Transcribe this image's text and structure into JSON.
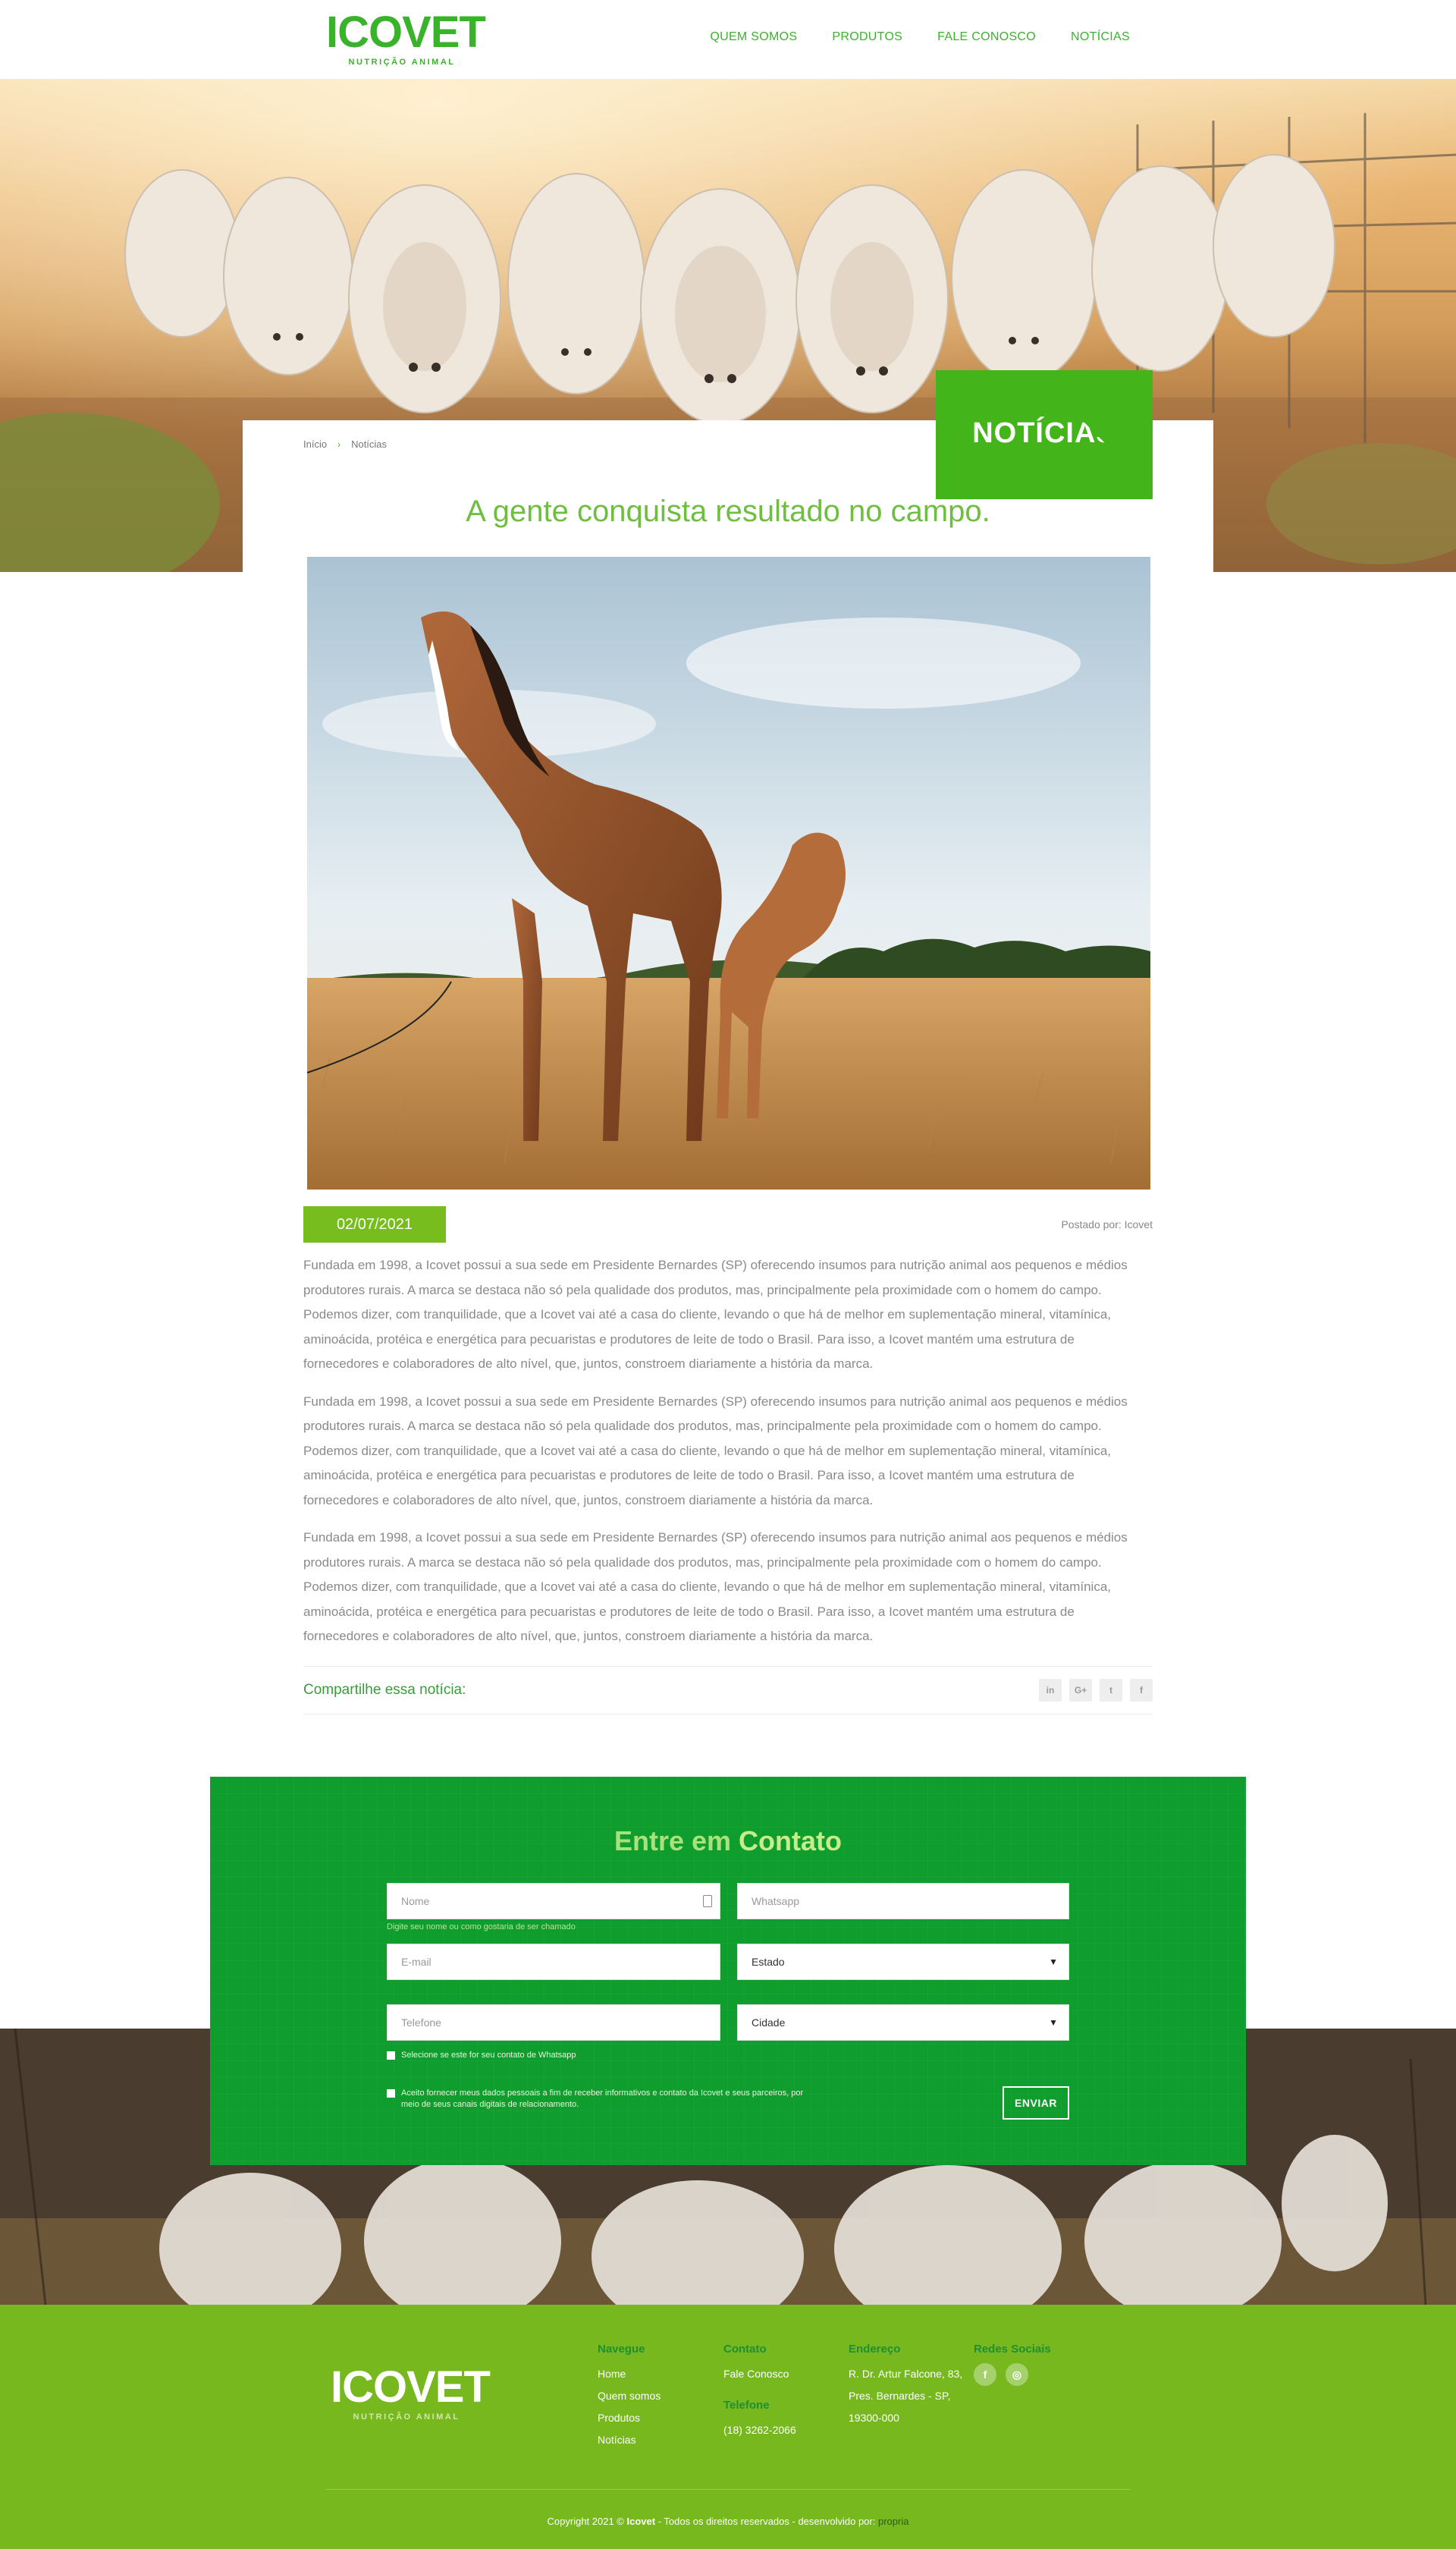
{
  "brand": {
    "logo_text": "ICOVET",
    "logo_subtitle": "NUTRIÇÃO ANIMAL",
    "accent": "#3bb22c",
    "green_box": "#43b51a",
    "contact_bg": "#0f9d2d",
    "footer_bg": "#76b81e"
  },
  "nav": {
    "items": [
      "QUEM SOMOS",
      "PRODUTOS",
      "FALE CONOSCO",
      "NOTÍCIAS"
    ]
  },
  "hero": {
    "title": "NOTÍCIAS"
  },
  "breadcrumb": {
    "home": "Início",
    "separator": "›",
    "current": "Notícias"
  },
  "article": {
    "title": "A gente conquista resultado no campo.",
    "date": "02/07/2021",
    "posted_by": "Postado por: Icovet",
    "paragraphs": [
      "Fundada em 1998, a Icovet possui a sua sede em Presidente Bernardes (SP) oferecendo insumos para nutrição animal aos pequenos e médios produtores rurais. A marca se destaca não só pela qualidade dos produtos, mas, principalmente pela proximidade com o homem do campo. Podemos dizer, com tranquilidade, que a Icovet vai até a casa do cliente, levando o que há de melhor em suplementação mineral, vitamínica, aminoácida, protéica e energética para pecuaristas e produtores de leite de todo o Brasil. Para isso, a Icovet mantém uma estrutura de fornecedores e colaboradores de alto nível, que, juntos, constroem diariamente a história da marca.",
      "Fundada em 1998, a Icovet possui a sua sede em Presidente Bernardes (SP) oferecendo insumos para nutrição animal aos pequenos e médios produtores rurais. A marca se destaca não só pela qualidade dos produtos, mas, principalmente pela proximidade com o homem do campo. Podemos dizer, com tranquilidade, que a Icovet vai até a casa do cliente, levando o que há de melhor em suplementação mineral, vitamínica, aminoácida, protéica e energética para pecuaristas e produtores de leite de todo o Brasil. Para isso, a Icovet mantém uma estrutura de fornecedores e colaboradores de alto nível, que, juntos, constroem diariamente a história da marca.",
      "Fundada em 1998, a Icovet possui a sua sede em Presidente Bernardes (SP) oferecendo insumos para nutrição animal aos pequenos e médios produtores rurais. A marca se destaca não só pela qualidade dos produtos, mas, principalmente pela proximidade com o homem do campo. Podemos dizer, com tranquilidade, que a Icovet vai até a casa do cliente, levando o que há de melhor em suplementação mineral, vitamínica, aminoácida, protéica e energética para pecuaristas e produtores de leite de todo o Brasil. Para isso, a Icovet mantém uma estrutura de fornecedores e colaboradores de alto nível, que, juntos, constroem diariamente a história da marca."
    ],
    "share_label": "Compartilhe essa notícia:",
    "share_icons": [
      {
        "icon": "linkedin-icon",
        "glyph": "in"
      },
      {
        "icon": "google-plus-icon",
        "glyph": "G+"
      },
      {
        "icon": "twitter-icon",
        "glyph": "t"
      },
      {
        "icon": "facebook-icon",
        "glyph": "f"
      }
    ]
  },
  "contact": {
    "title_light": "Entre em",
    "title_bold": "Contato",
    "name_placeholder": "Nome",
    "name_hint": "Digite seu nome ou como gostaria de ser chamado",
    "whatsapp_placeholder": "Whatsapp",
    "email_placeholder": "E-mail",
    "state_selected": "Estado",
    "phone_placeholder": "Telefone",
    "city_selected": "Cidade",
    "whatsapp_check": "Selecione se este for seu contato de Whatsapp",
    "consent_check": "Aceito fornecer meus dados pessoais a fim de receber informativos e contato da Icovet e seus parceiros, por meio de seus canais digitais de relacionamento.",
    "send": "ENVIAR"
  },
  "footer": {
    "navegue": {
      "title": "Navegue",
      "links": [
        "Home",
        "Quem somos",
        "Produtos",
        "Notícias"
      ]
    },
    "contato": {
      "title": "Contato",
      "link": "Fale Conosco",
      "phone_title": "Telefone",
      "phone": "(18) 3262-2066"
    },
    "endereco": {
      "title": "Endereço",
      "lines": [
        "R. Dr. Artur Falcone, 83,",
        "Pres. Bernardes - SP,",
        "19300-000"
      ]
    },
    "redes": {
      "title": "Redes Sociais",
      "icons": [
        {
          "icon": "facebook-icon",
          "glyph": "f"
        },
        {
          "icon": "instagram-icon",
          "glyph": "◎"
        }
      ]
    },
    "copyright_prefix": "Copyright 2021 ©",
    "copyright_brand": "Icovet",
    "copyright_rest": "- Todos os direitos reservados - desenvolvido por:",
    "developer": "propria"
  }
}
